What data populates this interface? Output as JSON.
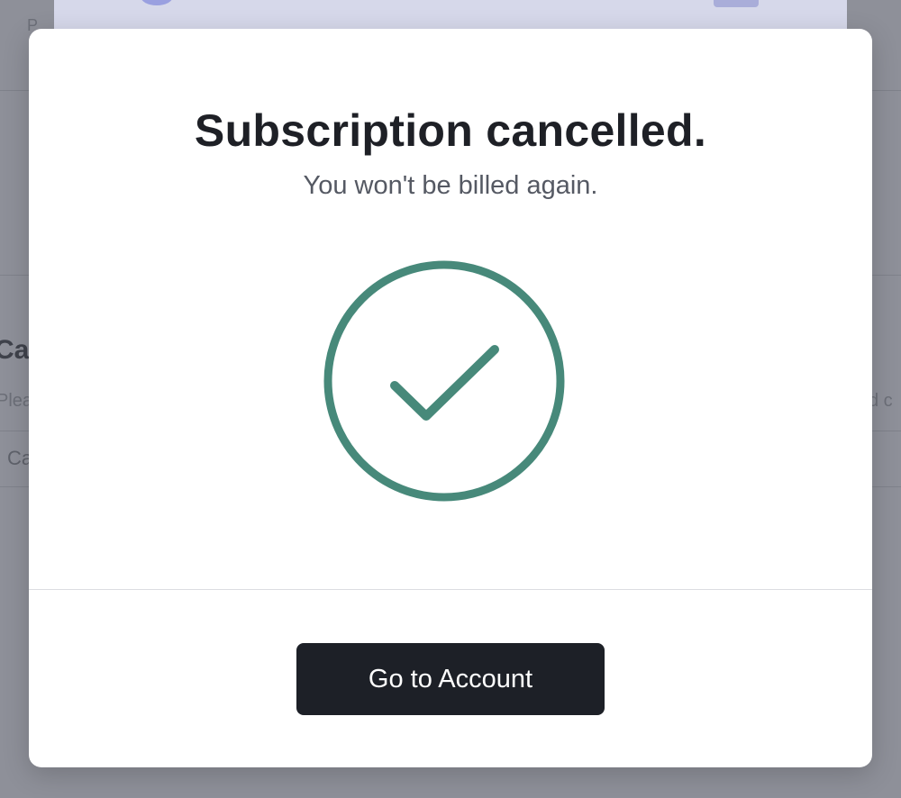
{
  "background": {
    "heading_fragment": "Ca",
    "subtext_fragment": "Plea",
    "subtext_right_fragment": "d c",
    "row_fragment": "Ca",
    "small_fragment": "P"
  },
  "modal": {
    "title": "Subscription cancelled.",
    "subtitle": "You won't be billed again.",
    "icon": "check-circle-icon",
    "icon_color": "#47897a",
    "button_label": "Go to Account"
  }
}
